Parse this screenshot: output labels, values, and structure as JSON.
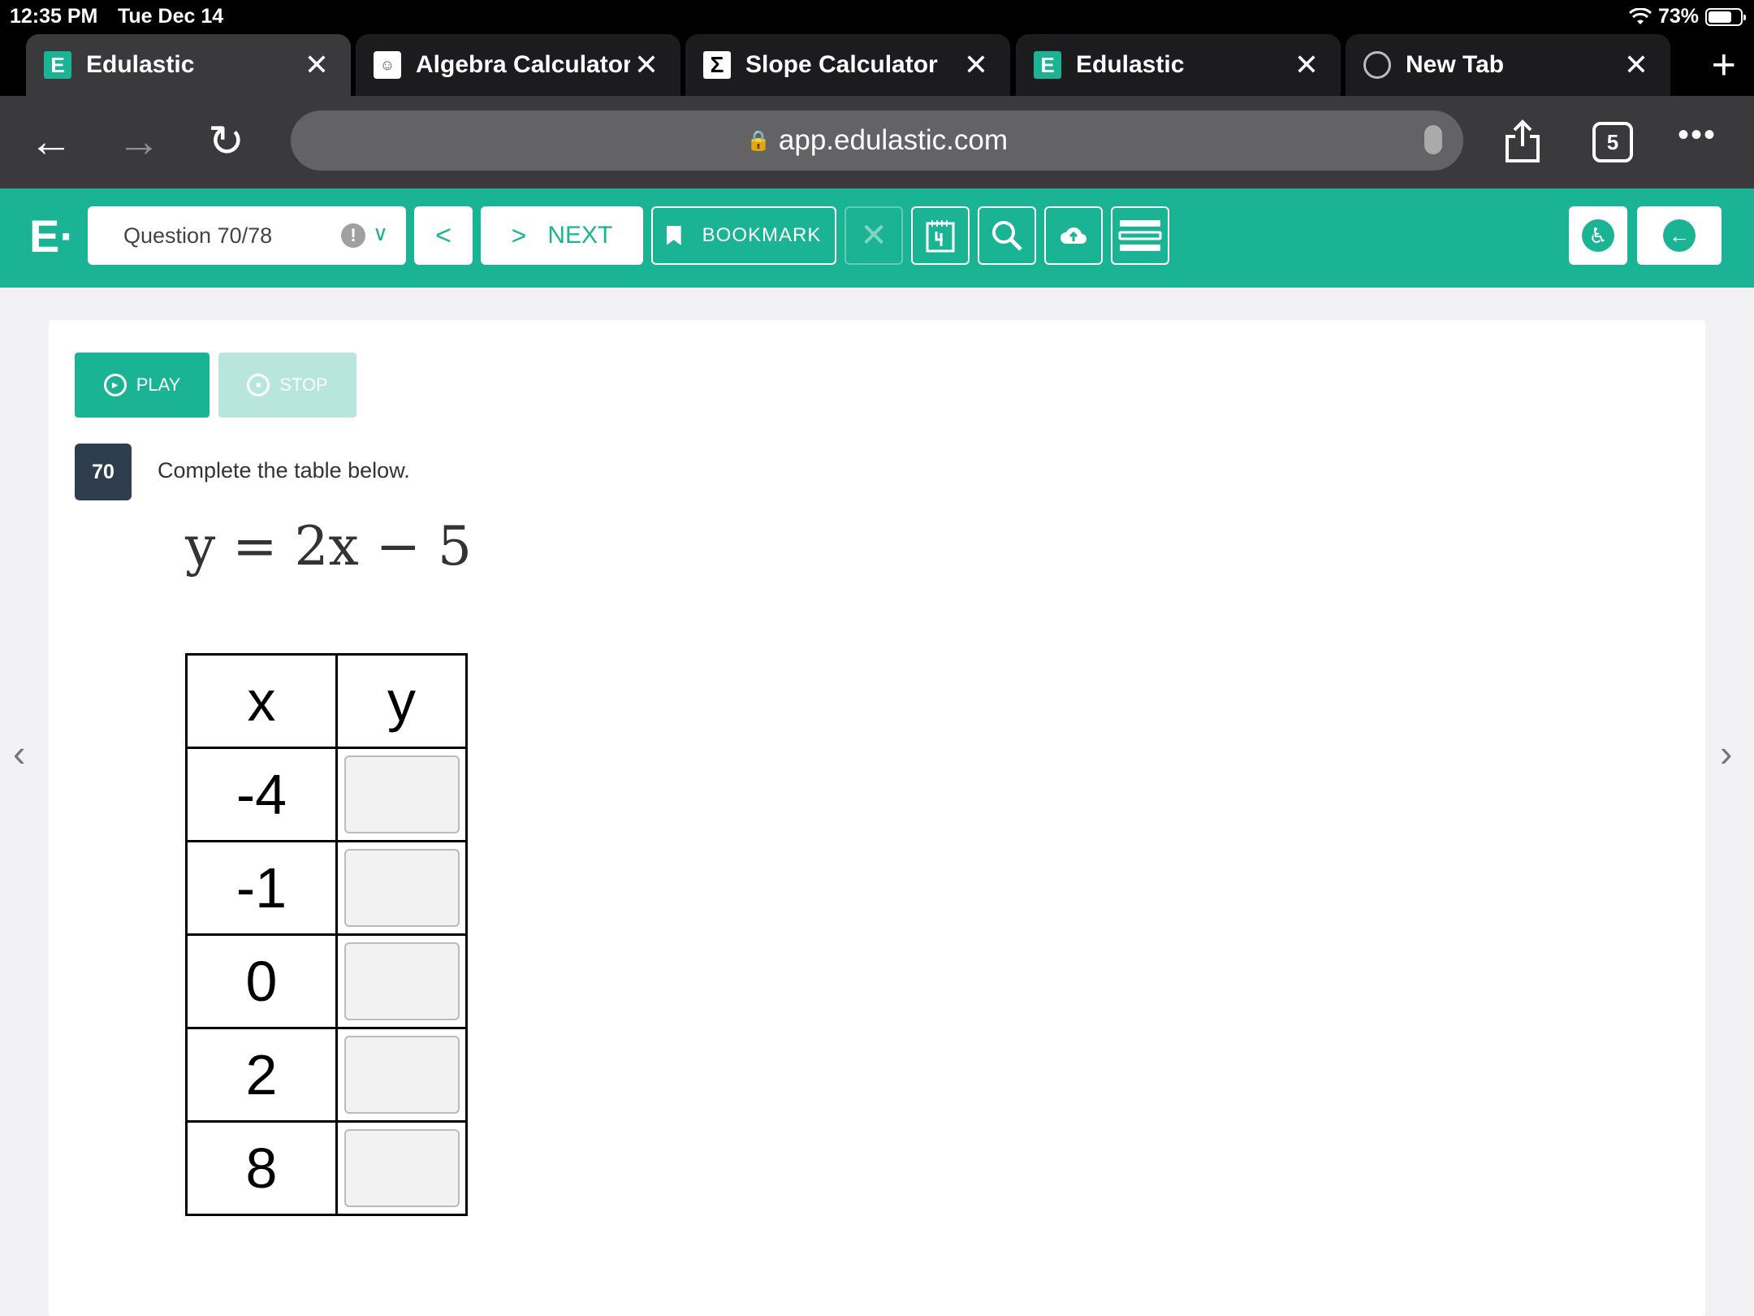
{
  "status_bar": {
    "time": "12:35 PM",
    "date": "Tue Dec 14",
    "wifi": "wifi-icon",
    "battery_percent": "73%",
    "battery_level": 0.73
  },
  "browser": {
    "tabs": [
      {
        "title": "Edulastic",
        "favicon": "edulastic-icon",
        "active": true
      },
      {
        "title": "Algebra Calculator -",
        "favicon": "calculator-icon",
        "active": false
      },
      {
        "title": "Slope Calculator",
        "favicon": "sigma-icon",
        "active": false
      },
      {
        "title": "Edulastic",
        "favicon": "edulastic-icon",
        "active": false
      },
      {
        "title": "New Tab",
        "favicon": "globe-icon",
        "active": false
      }
    ],
    "url": "app.edulastic.com",
    "tab_count": "5"
  },
  "edulastic": {
    "question_selector": "Question 70/78",
    "next_label": "NEXT",
    "bookmark_label": "BOOKMARK",
    "accent_color": "#1ab394"
  },
  "question": {
    "play_label": "PLAY",
    "stop_label": "STOP",
    "number": "70",
    "prompt": "Complete the table below.",
    "equation": "y = 2x − 5",
    "table": {
      "headers": [
        "x",
        "y"
      ],
      "rows": [
        {
          "x": "-4",
          "y": ""
        },
        {
          "x": "-1",
          "y": ""
        },
        {
          "x": "0",
          "y": ""
        },
        {
          "x": "2",
          "y": ""
        },
        {
          "x": "8",
          "y": ""
        }
      ]
    }
  }
}
